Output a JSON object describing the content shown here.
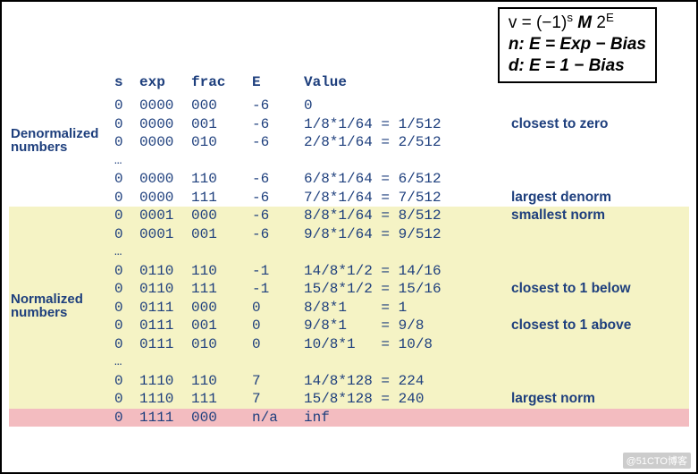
{
  "formula": {
    "line1_html": "v = (−1)<span class='sup'>s</span> <b><i>M</i></b> 2<span class='sup italic'>E</span>",
    "line2": "n: E = Exp − Bias",
    "line3": "d: E  =  1 − Bias"
  },
  "headers": {
    "s": "s",
    "exp": "exp",
    "frac": "frac",
    "E": "E",
    "val": "Value"
  },
  "side": {
    "denorm1": "Denormalized",
    "denorm2": "numbers",
    "norm1": "Normalized",
    "norm2": "numbers"
  },
  "rows": [
    {
      "s": "0",
      "exp": "0000",
      "frac": "000",
      "E": "-6",
      "val": "0",
      "note": "",
      "hl": ""
    },
    {
      "s": "0",
      "exp": "0000",
      "frac": "001",
      "E": "-6",
      "val": "1/8*1/64 = 1/512",
      "note": "closest to zero",
      "hl": ""
    },
    {
      "s": "0",
      "exp": "0000",
      "frac": "010",
      "E": "-6",
      "val": "2/8*1/64 = 2/512",
      "note": "",
      "hl": ""
    },
    {
      "ellipsis": true,
      "hl": ""
    },
    {
      "s": "0",
      "exp": "0000",
      "frac": "110",
      "E": "-6",
      "val": "6/8*1/64 = 6/512",
      "note": "",
      "hl": ""
    },
    {
      "s": "0",
      "exp": "0000",
      "frac": "111",
      "E": "-6",
      "val": "7/8*1/64 = 7/512",
      "note": "largest denorm",
      "hl": ""
    },
    {
      "s": "0",
      "exp": "0001",
      "frac": "000",
      "E": "-6",
      "val": "8/8*1/64 = 8/512",
      "note": "smallest norm",
      "hl": "y"
    },
    {
      "s": "0",
      "exp": "0001",
      "frac": "001",
      "E": "-6",
      "val": "9/8*1/64 = 9/512",
      "note": "",
      "hl": "y"
    },
    {
      "ellipsis": true,
      "hl": "y"
    },
    {
      "s": "0",
      "exp": "0110",
      "frac": "110",
      "E": "-1",
      "val": "14/8*1/2 = 14/16",
      "note": "",
      "hl": "y"
    },
    {
      "s": "0",
      "exp": "0110",
      "frac": "111",
      "E": "-1",
      "val": "15/8*1/2 = 15/16",
      "note": "closest to 1 below",
      "hl": "y"
    },
    {
      "s": "0",
      "exp": "0111",
      "frac": "000",
      "E": "0",
      "val": "8/8*1    = 1",
      "note": "",
      "hl": "y"
    },
    {
      "s": "0",
      "exp": "0111",
      "frac": "001",
      "E": "0",
      "val": "9/8*1    = 9/8",
      "note": "closest to 1 above",
      "hl": "y"
    },
    {
      "s": "0",
      "exp": "0111",
      "frac": "010",
      "E": "0",
      "val": "10/8*1   = 10/8",
      "note": "",
      "hl": "y"
    },
    {
      "ellipsis": true,
      "hl": "y"
    },
    {
      "s": "0",
      "exp": "1110",
      "frac": "110",
      "E": "7",
      "val": "14/8*128 = 224",
      "note": "",
      "hl": "y"
    },
    {
      "s": "0",
      "exp": "1110",
      "frac": "111",
      "E": "7",
      "val": "15/8*128 = 240",
      "note": "largest norm",
      "hl": "y"
    },
    {
      "s": "0",
      "exp": "1111",
      "frac": "000",
      "E": "n/a",
      "val": "inf",
      "note": "",
      "hl": "p"
    }
  ],
  "side_positions": {
    "denorm_at": 2,
    "norm_at": 11
  },
  "watermark": "@51CTO博客"
}
